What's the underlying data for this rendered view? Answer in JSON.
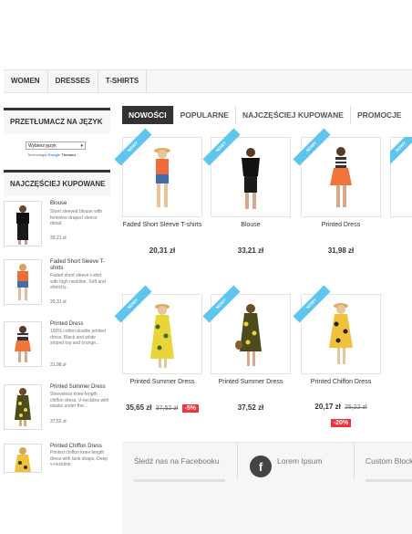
{
  "topnav": {
    "items": [
      "WOMEN",
      "DRESSES",
      "T-SHIRTS"
    ]
  },
  "sidebar": {
    "translator_title": "PRZETŁUMACZ NA JĘZYK",
    "lang_select_value": "Wybierz język",
    "powered_prefix": "Technologia",
    "powered_google": "Google",
    "powered_suffix": "Tłumacz",
    "best_title": "NAJCZĘŚCIEJ KUPOWANE",
    "best_items": [
      {
        "name": "Blouse",
        "desc": "Short sleeved blouse with feminine draped sleeve detail.",
        "price": "33,21 zł"
      },
      {
        "name": "Faded Short Sleeve T-shirts",
        "desc": "Faded short sleeve t-shirt with high neckline. Soft and stretchy...",
        "price": "20,31 zł"
      },
      {
        "name": "Printed Dress",
        "desc": "100% cotton double printed dress. Black and white striped top and orange...",
        "price": "31,98 zł"
      },
      {
        "name": "Printed Summer Dress",
        "desc": "Sleeveless knee-length chiffon dress. V-neckline with elastic under the...",
        "price": "37,52 zł"
      },
      {
        "name": "Printed Chiffon Dress",
        "desc": "Printed chiffon knee length dress with tank straps. Deep v-neckline.",
        "price": ""
      }
    ]
  },
  "tabs": [
    "NOWOŚCI",
    "POPULARNE",
    "NAJCZĘŚCIEJ KUPOWANE",
    "PROMOCJE"
  ],
  "ribbon_label": "NOWY",
  "products": [
    {
      "name": "Faded Short Sleeve T-shirts",
      "price": "20,31 zł",
      "old_price": "",
      "discount": ""
    },
    {
      "name": "Blouse",
      "price": "33,21 zł",
      "old_price": "",
      "discount": ""
    },
    {
      "name": "Printed Dress",
      "price": "31,98 zł",
      "old_price": "",
      "discount": ""
    },
    {
      "name": "Printed Summer Dress",
      "price": "35,65 zł",
      "old_price": "37,52 zł",
      "discount": "-5%"
    },
    {
      "name": "Printed Summer Dress",
      "price": "37,52 zł",
      "old_price": "",
      "discount": ""
    },
    {
      "name": "Printed Chiffon Dress",
      "price": "20,17 zł",
      "old_price": "25,22 zł",
      "discount": "-20%"
    }
  ],
  "footer": {
    "facebook": "Śledź nas na Facebooku",
    "lorem": "Lorem Ipsum",
    "custom": "Custom Block"
  },
  "colors": {
    "ribbon": "#5ec5ee",
    "discount": "#f13340",
    "active_tab": "#333333"
  }
}
